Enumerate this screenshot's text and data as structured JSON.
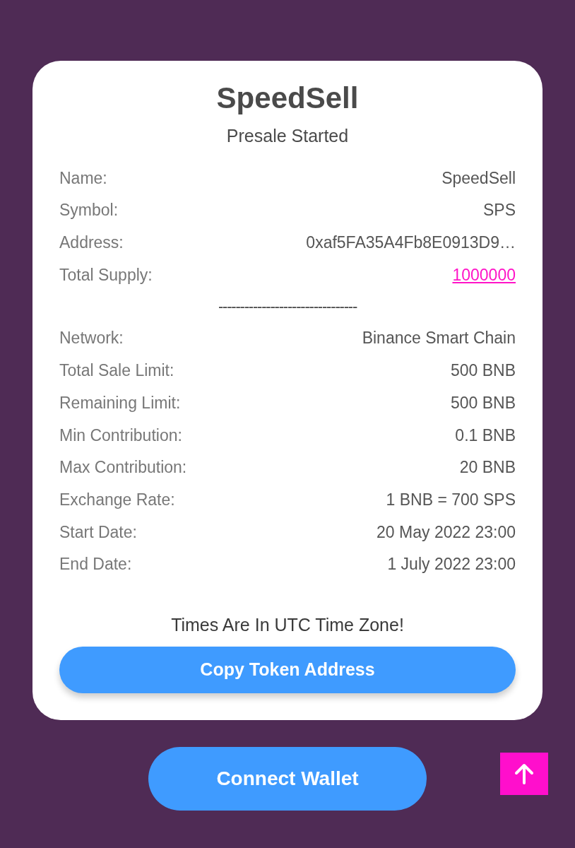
{
  "card": {
    "title": "SpeedSell",
    "subtitle": "Presale Started",
    "token_rows": [
      {
        "label": "Name:",
        "value": "SpeedSell",
        "kind": "text"
      },
      {
        "label": "Symbol:",
        "value": "SPS",
        "kind": "text"
      },
      {
        "label": "Address:",
        "value": "0xaf5FA35A4Fb8E0913D9…",
        "kind": "text"
      },
      {
        "label": "Total Supply:",
        "value": "1000000",
        "kind": "link"
      }
    ],
    "separator": "--------------------------------",
    "sale_rows": [
      {
        "label": "Network:",
        "value": "Binance Smart Chain",
        "kind": "text"
      },
      {
        "label": "Total Sale Limit:",
        "value": "500 BNB",
        "kind": "text"
      },
      {
        "label": "Remaining Limit:",
        "value": "500 BNB",
        "kind": "text"
      },
      {
        "label": "Min Contribution:",
        "value": "0.1 BNB",
        "kind": "text"
      },
      {
        "label": "Max Contribution:",
        "value": "20 BNB",
        "kind": "text"
      },
      {
        "label": "Exchange Rate:",
        "value": "1 BNB = 700 SPS",
        "kind": "text"
      },
      {
        "label": "Start Date:",
        "value": "20 May 2022 23:00",
        "kind": "text"
      },
      {
        "label": "End Date:",
        "value": "1 July 2022 23:00",
        "kind": "text"
      }
    ],
    "note": "Times Are In UTC Time Zone!",
    "copy_button": "Copy Token Address"
  },
  "connect_button": "Connect Wallet"
}
